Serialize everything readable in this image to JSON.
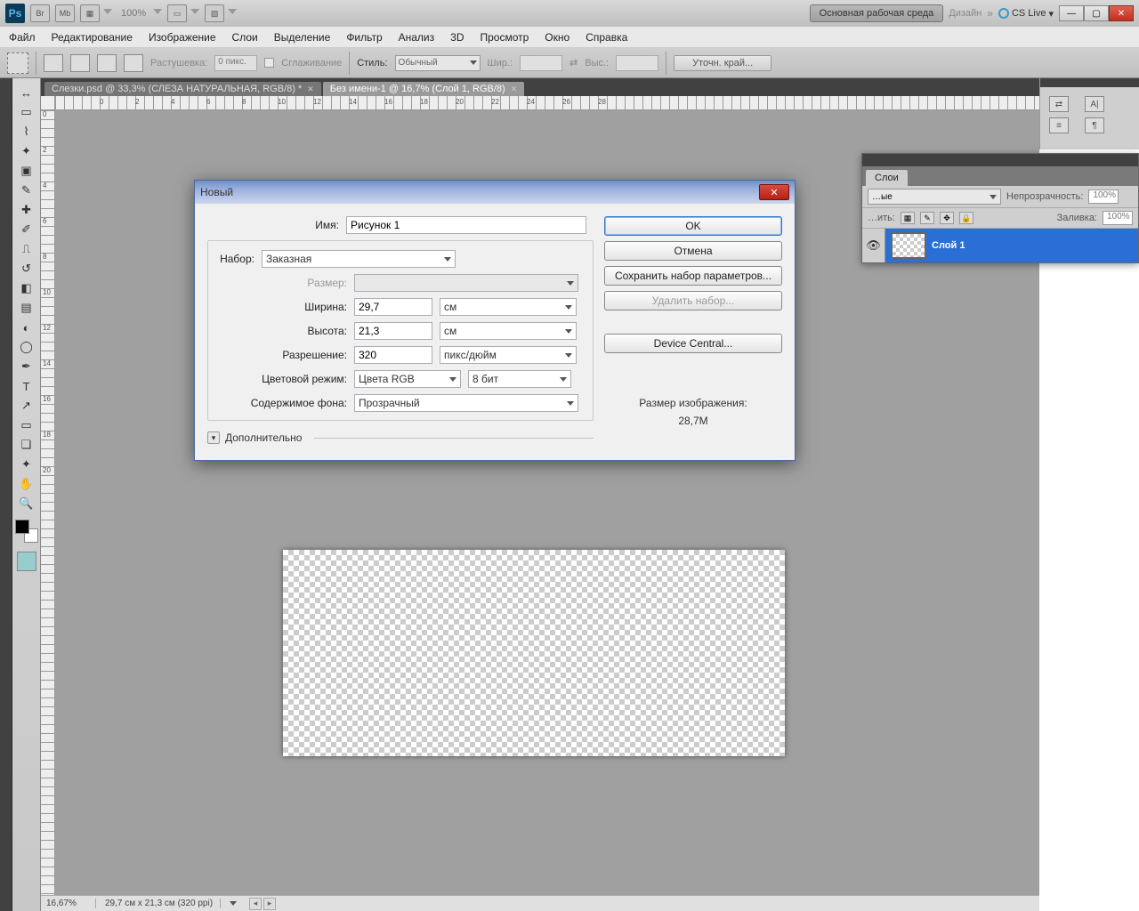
{
  "titlebar": {
    "ps": "Ps",
    "br": "Br",
    "mb": "Mb",
    "zoom": "100%",
    "workspace_main": "Основная рабочая среда",
    "workspace_design": "Дизайн",
    "cslive": "CS Live"
  },
  "menu": [
    "Файл",
    "Редактирование",
    "Изображение",
    "Слои",
    "Выделение",
    "Фильтр",
    "Анализ",
    "3D",
    "Просмотр",
    "Окно",
    "Справка"
  ],
  "options": {
    "feather_lbl": "Растушевка:",
    "feather_val": "0 пикс.",
    "antialias": "Сглаживание",
    "style_lbl": "Стиль:",
    "style_val": "Обычный",
    "width_lbl": "Шир.:",
    "height_lbl": "Выс.:",
    "refine": "Уточн. край..."
  },
  "tabs": [
    "Слезки.psd @ 33,3% (СЛЕЗА НАТУРАЛЬНАЯ, RGB/8) *",
    "Без имени-1 @ 16,7% (Слой 1, RGB/8)"
  ],
  "ruler_h": [
    "0",
    "2",
    "4",
    "6",
    "8",
    "10",
    "12",
    "14",
    "16",
    "18",
    "20",
    "22",
    "24",
    "26",
    "28"
  ],
  "ruler_v": [
    "0",
    "2",
    "4",
    "6",
    "8",
    "10",
    "12",
    "14",
    "16",
    "18",
    "20"
  ],
  "status": {
    "zoom": "16,67%",
    "dims": "29,7 см x 21,3 см (320 ppi)"
  },
  "layers": {
    "tab": "Слои",
    "blend": "…ые",
    "opacity_lbl": "Непрозрачность:",
    "opacity_val": "100%",
    "lock_lbl": "…ить:",
    "fill_lbl": "Заливка:",
    "fill_val": "100%",
    "layer1": "Слой 1"
  },
  "dialog": {
    "title": "Новый",
    "name_lbl": "Имя:",
    "name_val": "Рисунок 1",
    "preset_lbl": "Набор:",
    "preset_val": "Заказная",
    "size_lbl": "Размер:",
    "width_lbl": "Ширина:",
    "width_val": "29,7",
    "width_unit": "см",
    "height_lbl": "Высота:",
    "height_val": "21,3",
    "height_unit": "см",
    "res_lbl": "Разрешение:",
    "res_val": "320",
    "res_unit": "пикс/дюйм",
    "mode_lbl": "Цветовой режим:",
    "mode_val": "Цвета RGB",
    "mode_bits": "8 бит",
    "bg_lbl": "Содержимое фона:",
    "bg_val": "Прозрачный",
    "advanced": "Дополнительно",
    "ok": "OK",
    "cancel": "Отмена",
    "save_preset": "Сохранить набор параметров...",
    "delete_preset": "Удалить набор...",
    "device_central": "Device Central...",
    "img_size_lbl": "Размер изображения:",
    "img_size_val": "28,7M"
  }
}
